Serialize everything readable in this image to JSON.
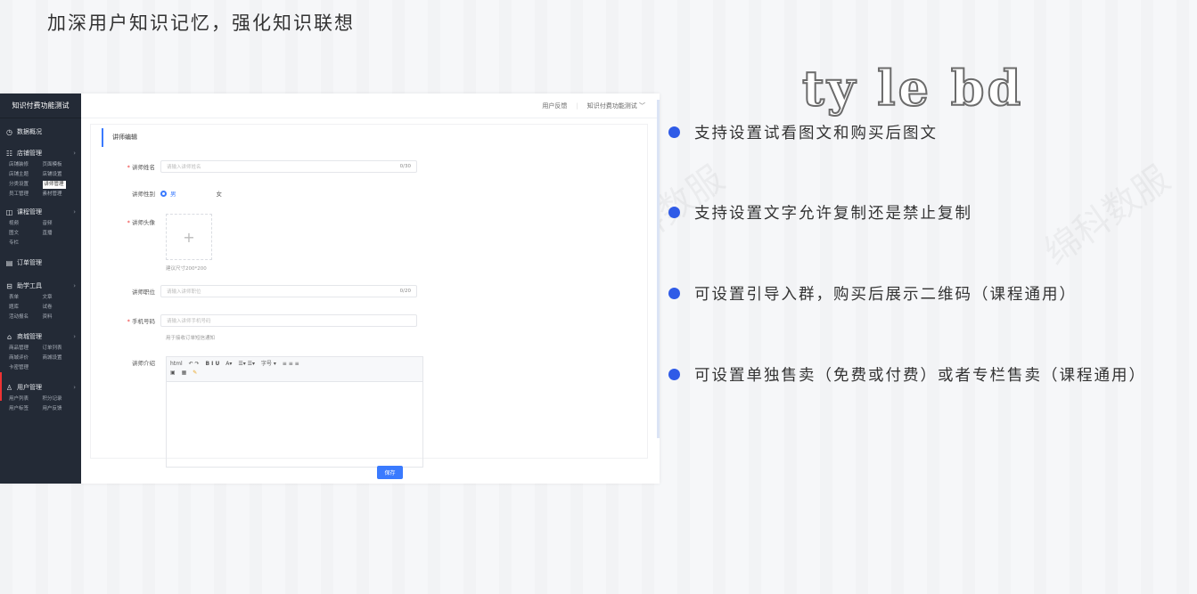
{
  "headline": "加深用户知识记忆，强化知识联想",
  "logo_text": "ty le bd",
  "watermark": "绵科数服",
  "features": [
    "支持设置试看图文和购买后图文",
    "支持设置文字允许复制还是禁止复制",
    "可设置引导入群，购买后展示二维码（课程通用）",
    "可设置单独售卖（免费或付费）或者专栏售卖（课程通用）"
  ],
  "colors": {
    "accent": "#3a7afe",
    "bullet": "#2f5be7",
    "sidebar": "#232a36"
  },
  "app": {
    "brand": "知识付费功能测试",
    "topbar": {
      "feedback": "用户反馈",
      "account": "知识付费功能测试 ﹀"
    },
    "sidebar": {
      "overview": {
        "icon": "clock-icon",
        "label": "数据概况"
      },
      "store": {
        "icon": "store-icon",
        "label": "店铺管理",
        "items": [
          "店铺装修",
          "页面模板",
          "店铺主题",
          "店铺设置",
          "分类设置",
          "讲师管理",
          "员工管理",
          "素材管理"
        ]
      },
      "course": {
        "icon": "book-icon",
        "label": "课程管理",
        "items": [
          "视频",
          "音频",
          "图文",
          "直播",
          "专栏"
        ]
      },
      "orders": {
        "icon": "order-icon",
        "label": "订单管理"
      },
      "tools": {
        "icon": "toolbox-icon",
        "label": "助学工具",
        "items": [
          "表单",
          "文章",
          "题库",
          "试卷",
          "活动报名",
          "资料"
        ]
      },
      "mall": {
        "icon": "bag-icon",
        "label": "商城管理",
        "items": [
          "商品管理",
          "订单列表",
          "商城评价",
          "商城设置",
          "卡密管理"
        ]
      },
      "users": {
        "icon": "user-icon",
        "label": "用户管理",
        "items": [
          "用户列表",
          "积分记录",
          "用户标签",
          "用户反馈"
        ]
      }
    },
    "form": {
      "title": "讲师编辑",
      "name": {
        "label": "讲师姓名",
        "placeholder": "请输入讲师姓名",
        "count": "0/30"
      },
      "gender": {
        "label": "讲师性别",
        "male": "男",
        "female": "女"
      },
      "avatar": {
        "label": "讲师头像",
        "hint": "建议尺寸200*200"
      },
      "position": {
        "label": "讲师职位",
        "placeholder": "请输入讲师职位",
        "count": "0/20"
      },
      "phone": {
        "label": "手机号码",
        "placeholder": "请输入讲师手机号码",
        "hint": "用于接收订单短信通知"
      },
      "intro": {
        "label": "讲师介绍"
      },
      "toolbar": [
        "html",
        "↶ ↷",
        "B I U",
        "A▾",
        "☰▾ ☰▾",
        "字号 ▾",
        "≡ ≡ ≡"
      ],
      "save": "保存"
    }
  }
}
